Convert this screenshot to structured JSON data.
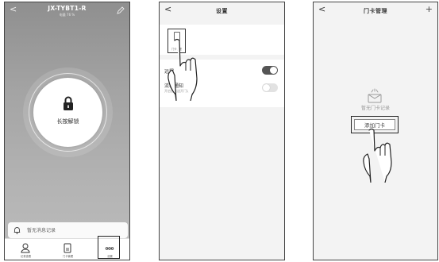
{
  "screen_lock": {
    "back_label": "<",
    "device_name": "JX-TYBT1-R",
    "device_status": "电量 76 %",
    "unlock_label": "长按解锁",
    "message_text": "暂无消息记录",
    "tabs": [
      {
        "label": "记录查看",
        "icon": "user-icon"
      },
      {
        "label": "门卡管理",
        "icon": "card-icon"
      },
      {
        "label": "设置",
        "icon": "more-icon"
      }
    ]
  },
  "screen_settings": {
    "back_label": "<",
    "title": "设置",
    "card_option_label": "门卡管理",
    "rows": [
      {
        "label": "远程",
        "toggle": "on"
      },
      {
        "label": "流程通知",
        "sublabel": "开启后推送开门记录",
        "toggle": "off"
      }
    ]
  },
  "screen_card": {
    "back_label": "<",
    "title": "门卡管理",
    "add_icon": "+",
    "empty_text": "暂无门卡记录",
    "add_button": "添加门卡"
  },
  "colors": {
    "lock_bg": "#9e9e9e",
    "toggle_on": "#555555",
    "toggle_off": "#e2e2e2"
  }
}
